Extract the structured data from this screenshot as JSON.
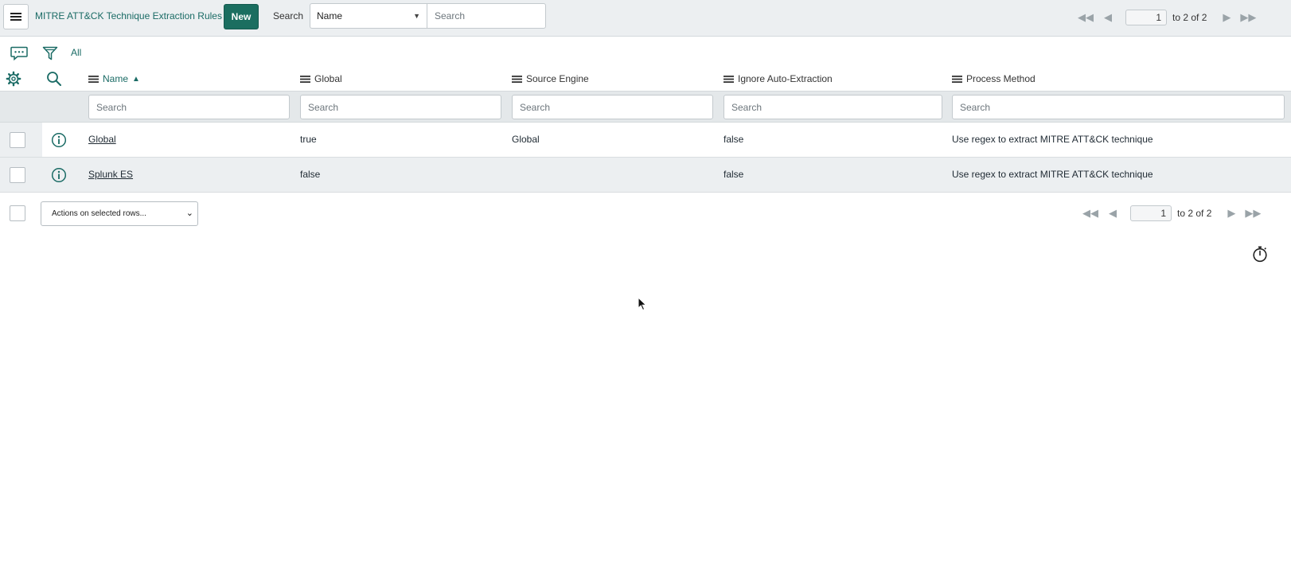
{
  "header": {
    "menu_icon": "hamburger-menu-icon",
    "title": "MITRE ATT&CK Technique Extraction Rules",
    "new_label": "New",
    "search_label": "Search",
    "search_field_value": "Name",
    "search_placeholder": "Search"
  },
  "pager_top": {
    "page": "1",
    "range": "to 2 of 2"
  },
  "toolbar": {
    "breadcrumb": "All"
  },
  "columns": [
    {
      "label": "Name",
      "sorted": "ascending"
    },
    {
      "label": "Global"
    },
    {
      "label": "Source Engine"
    },
    {
      "label": "Ignore Auto-Extraction"
    },
    {
      "label": "Process Method"
    }
  ],
  "column_search_placeholder": "Search",
  "rows": [
    {
      "name": "Global",
      "global": "true",
      "source_engine": "Global",
      "ignore_auto_extraction": "false",
      "process_method": "Use regex to extract MITRE ATT&CK technique"
    },
    {
      "name": "Splunk ES",
      "global": "false",
      "source_engine": "",
      "ignore_auto_extraction": "false",
      "process_method": "Use regex to extract MITRE ATT&CK technique"
    }
  ],
  "footer": {
    "actions_label": "Actions on selected rows...",
    "pager": {
      "page": "1",
      "range": "to 2 of 2"
    }
  },
  "colors": {
    "accent": "#1a6b65",
    "new_button": "#1b6e60",
    "header_bg": "#eceff1"
  }
}
